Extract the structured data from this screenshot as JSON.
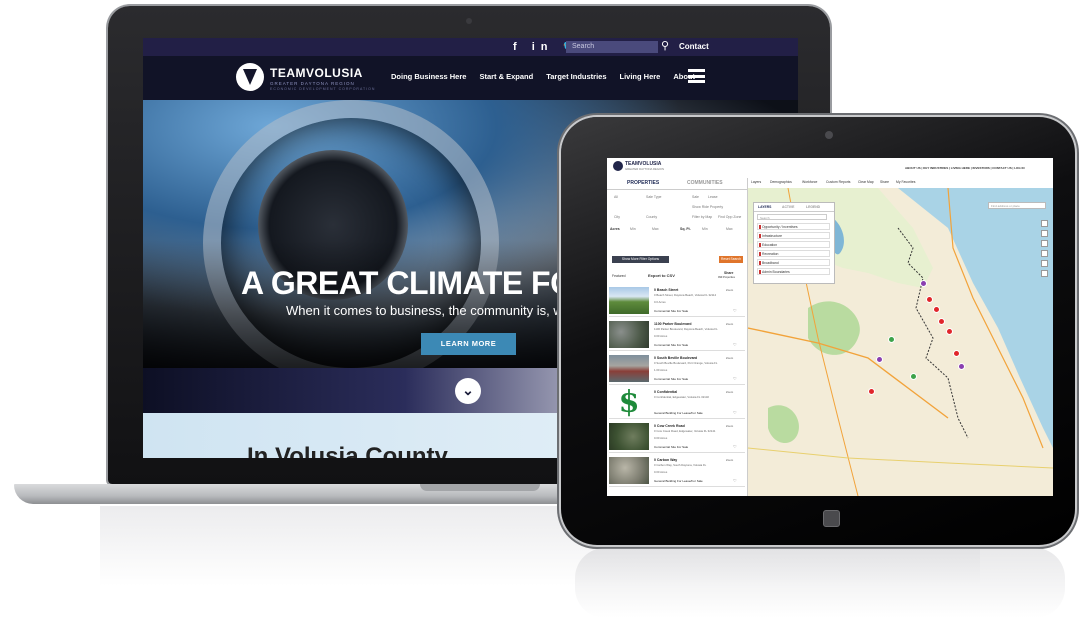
{
  "laptop_site": {
    "topbar": {
      "social": "f in 🐦",
      "search_placeholder": "Search",
      "contact": "Contact"
    },
    "logo": {
      "name": "TEAMVOLUSIA",
      "subtitle": "GREATER DAYTONA REGION",
      "subtitle2": "ECONOMIC DEVELOPMENT CORPORATION"
    },
    "nav": [
      "Doing Business Here",
      "Start & Expand",
      "Target Industries",
      "Living Here",
      "About"
    ],
    "hero": {
      "title": "A GREAT CLIMATE FOR B",
      "subtitle": "When it comes to business, the community is, w",
      "button": "LEARN MORE"
    },
    "scroll_glyph": "⌄",
    "section_title": "In Volusia County"
  },
  "tablet_app": {
    "logo": {
      "name": "TEAMVOLUSIA",
      "subtitle": "GREATER DAYTONA REGION"
    },
    "top_links": "ABOUT US  |  KEY INDUSTRIES  |  LIVING HERE  |  INVESTORS  |  CONTACT US  |  LOG IN",
    "tabs": {
      "properties": "PROPERTIES",
      "communities": "COMMUNITIES"
    },
    "filters": {
      "all": "All",
      "sale_type": "Sale Type",
      "sale": "Sale",
      "lease": "Lease",
      "show_ride": "Show Ride Property",
      "city": "City",
      "county": "County",
      "filter_by_map": "Filter by Map",
      "find_zone": "Find Opp Zone",
      "acres": "Acres",
      "min": "Min",
      "max": "Max",
      "sqft": "Sq. Ft."
    },
    "more_filters_button": "Show More Filter Options",
    "reset_button": "Reset Search",
    "sort": {
      "label": "Featured",
      "export": "Export to CSV",
      "share": "Share",
      "count": "999 Properties"
    },
    "listings": [
      {
        "title": "0 Beach Street",
        "address": "0 Beach Street, Daytona Beach, Volusia FL 32114",
        "acres": "0.0 Acres",
        "type": "Commercial Site   For Sale"
      },
      {
        "title": "1100 Parker Boulevard",
        "address": "1100 Parker Boulevard, Daytona Beach, Volusia FL",
        "acres": "0.00 Acres",
        "type": "Commercial Site   For Sale"
      },
      {
        "title": "0 South Beville Boulevard",
        "address": "0 South Beville Boulevard, Port Orange, Volusia FL",
        "acres": "1.00 Acres",
        "type": "Commercial Site   For Sale"
      },
      {
        "title": "0 Confidential",
        "address": "0 Confidential, Edgewater, Volusia FL 32132",
        "acres": "",
        "type": "General Building   For Lease/For Sale"
      },
      {
        "title": "0 Cow Creek Road",
        "address": "0 Cow Creek Road, Edgewater, Volusia FL 32141",
        "acres": "0.00 Acres",
        "type": "Commercial Site   For Sale"
      },
      {
        "title": "0 Carbon Way",
        "address": "0 Carbon Way, South Daytona, Volusia FL",
        "acres": "0.00 Acres",
        "type": "General Building   For Lease/For Sale"
      }
    ],
    "zoom_label": "Zoom",
    "toolbar": {
      "layers": "Layers",
      "demographics": "Demographics",
      "workforce": "Workforce",
      "custom_reports": "Custom Reports",
      "clear_map": "Clear Map",
      "share": "Share",
      "favorites": "My Favorites"
    },
    "layer_panel": {
      "tabs": [
        "LAYERS",
        "ACTIVE",
        "LEGEND"
      ],
      "search_placeholder": "Search",
      "items": [
        "Opportunity / Incentives",
        "Infrastructure",
        "Education",
        "Recreation",
        "Broadband",
        "Admin Boundaries"
      ]
    },
    "map_search_placeholder": "Find address or place"
  },
  "colors": {
    "nav_bg": "#221f46",
    "button_blue": "#3c89b5",
    "reset_orange": "#e0752b",
    "pin_red": "#e0262b",
    "pin_purple": "#8a3fb0",
    "pin_green": "#3da34a"
  }
}
